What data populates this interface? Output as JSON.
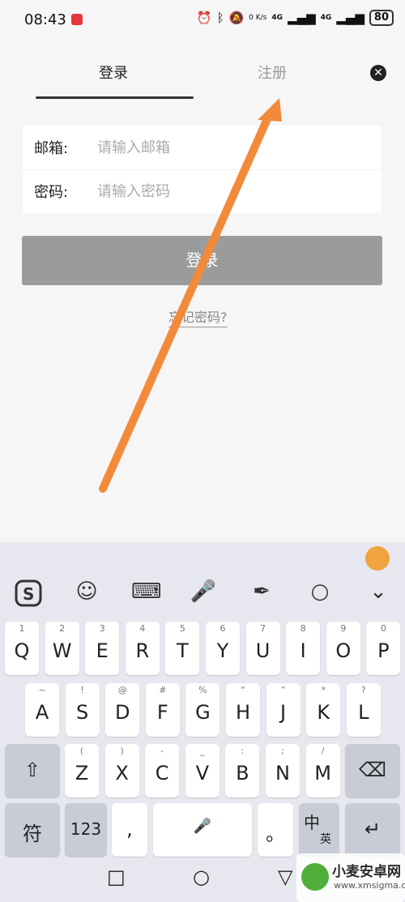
{
  "status": {
    "time": "08:43",
    "net_speed": "0 K/s",
    "net1": "4G",
    "net2": "4G",
    "battery": "80"
  },
  "tabs": {
    "login": "登录",
    "register": "注册"
  },
  "form": {
    "email_label": "邮箱:",
    "email_placeholder": "请输入邮箱",
    "password_label": "密码:",
    "password_placeholder": "请输入密码"
  },
  "login_button": "登录",
  "forgot_password": "忘记密码?",
  "keyboard": {
    "row1": [
      {
        "k": "Q",
        "h": "1"
      },
      {
        "k": "W",
        "h": "2"
      },
      {
        "k": "E",
        "h": "3"
      },
      {
        "k": "R",
        "h": "4"
      },
      {
        "k": "T",
        "h": "5"
      },
      {
        "k": "Y",
        "h": "6"
      },
      {
        "k": "U",
        "h": "7"
      },
      {
        "k": "I",
        "h": "8"
      },
      {
        "k": "O",
        "h": "9"
      },
      {
        "k": "P",
        "h": "0"
      }
    ],
    "row2": [
      {
        "k": "A",
        "h": "~"
      },
      {
        "k": "S",
        "h": "!"
      },
      {
        "k": "D",
        "h": "@"
      },
      {
        "k": "F",
        "h": "#"
      },
      {
        "k": "G",
        "h": "%"
      },
      {
        "k": "H",
        "h": "“"
      },
      {
        "k": "J",
        "h": "”"
      },
      {
        "k": "K",
        "h": "*"
      },
      {
        "k": "L",
        "h": "?"
      }
    ],
    "row3": [
      {
        "k": "Z",
        "h": "("
      },
      {
        "k": "X",
        "h": ")"
      },
      {
        "k": "C",
        "h": "-"
      },
      {
        "k": "V",
        "h": "_"
      },
      {
        "k": "B",
        "h": ":"
      },
      {
        "k": "N",
        "h": ";"
      },
      {
        "k": "M",
        "h": "/"
      }
    ],
    "symbol_key": "符",
    "num_key": "123",
    "comma_key": ",",
    "period_key": "。",
    "lang_key_main": "中",
    "lang_key_sub": "英"
  },
  "watermark": {
    "title": "小麦安卓网",
    "url": "www.xmsigma.com"
  },
  "colors": {
    "arrow": "#f28a3a",
    "login_button_bg": "#9a9c9c"
  }
}
